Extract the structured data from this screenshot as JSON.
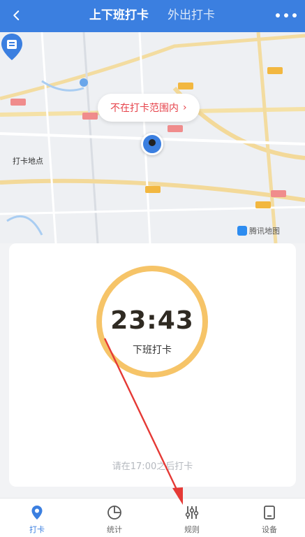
{
  "header": {
    "tabs": [
      {
        "label": "上下班打卡",
        "active": true
      },
      {
        "label": "外出打卡",
        "active": false
      }
    ]
  },
  "map": {
    "range_status": "不在打卡范围内",
    "range_chevron": "›",
    "pin_label": "打卡地点",
    "provider": "腾讯地图"
  },
  "clock": {
    "time": "23:43",
    "action": "下班打卡",
    "hint": "请在17:00之后打卡"
  },
  "tabbar": {
    "items": [
      {
        "label": "打卡",
        "icon": "location-pin-icon",
        "active": true
      },
      {
        "label": "统计",
        "icon": "clock-chart-icon",
        "active": false
      },
      {
        "label": "规则",
        "icon": "sliders-icon",
        "active": false
      },
      {
        "label": "设备",
        "icon": "device-icon",
        "active": false
      }
    ]
  },
  "colors": {
    "primary": "#3b7fe0",
    "ring": "#f6c468",
    "warning": "#e6434b",
    "annotation_arrow": "#e53935"
  }
}
